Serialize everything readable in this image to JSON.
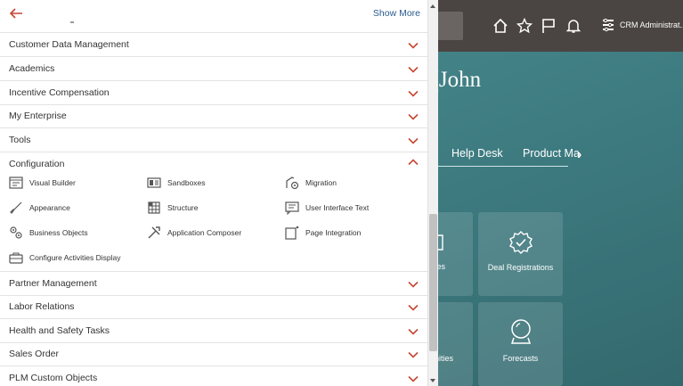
{
  "header": {
    "user_label": "CRM Administrat...",
    "icons": [
      "home-icon",
      "star-icon",
      "flag-icon",
      "bell-icon",
      "settings-list-icon"
    ]
  },
  "background": {
    "greeting": "r (John",
    "tabs": [
      "Help Desk",
      "Product Ma"
    ],
    "tiles": [
      {
        "label": "es"
      },
      {
        "label": "Deal Registrations"
      },
      {
        "label": "nities"
      },
      {
        "label": "Forecasts"
      }
    ]
  },
  "drawer": {
    "show_more": "Show More",
    "sections": {
      "customer_data": "Customer Data Management",
      "academics": "Academics",
      "incentive": "Incentive Compensation",
      "my_enterprise": "My Enterprise",
      "tools": "Tools",
      "configuration": "Configuration",
      "partner": "Partner Management",
      "labor": "Labor Relations",
      "health": "Health and Safety Tasks",
      "sales_order": "Sales Order",
      "plm": "PLM Custom Objects"
    },
    "config_items": {
      "visual_builder": "Visual Builder",
      "sandboxes": "Sandboxes",
      "migration": "Migration",
      "appearance": "Appearance",
      "structure": "Structure",
      "ui_text": "User Interface Text",
      "business_objects": "Business Objects",
      "app_composer": "Application Composer",
      "page_integration": "Page Integration",
      "activities_display": "Configure Activities Display"
    }
  },
  "colors": {
    "accent": "#c74634",
    "link": "#2a5b8f"
  }
}
